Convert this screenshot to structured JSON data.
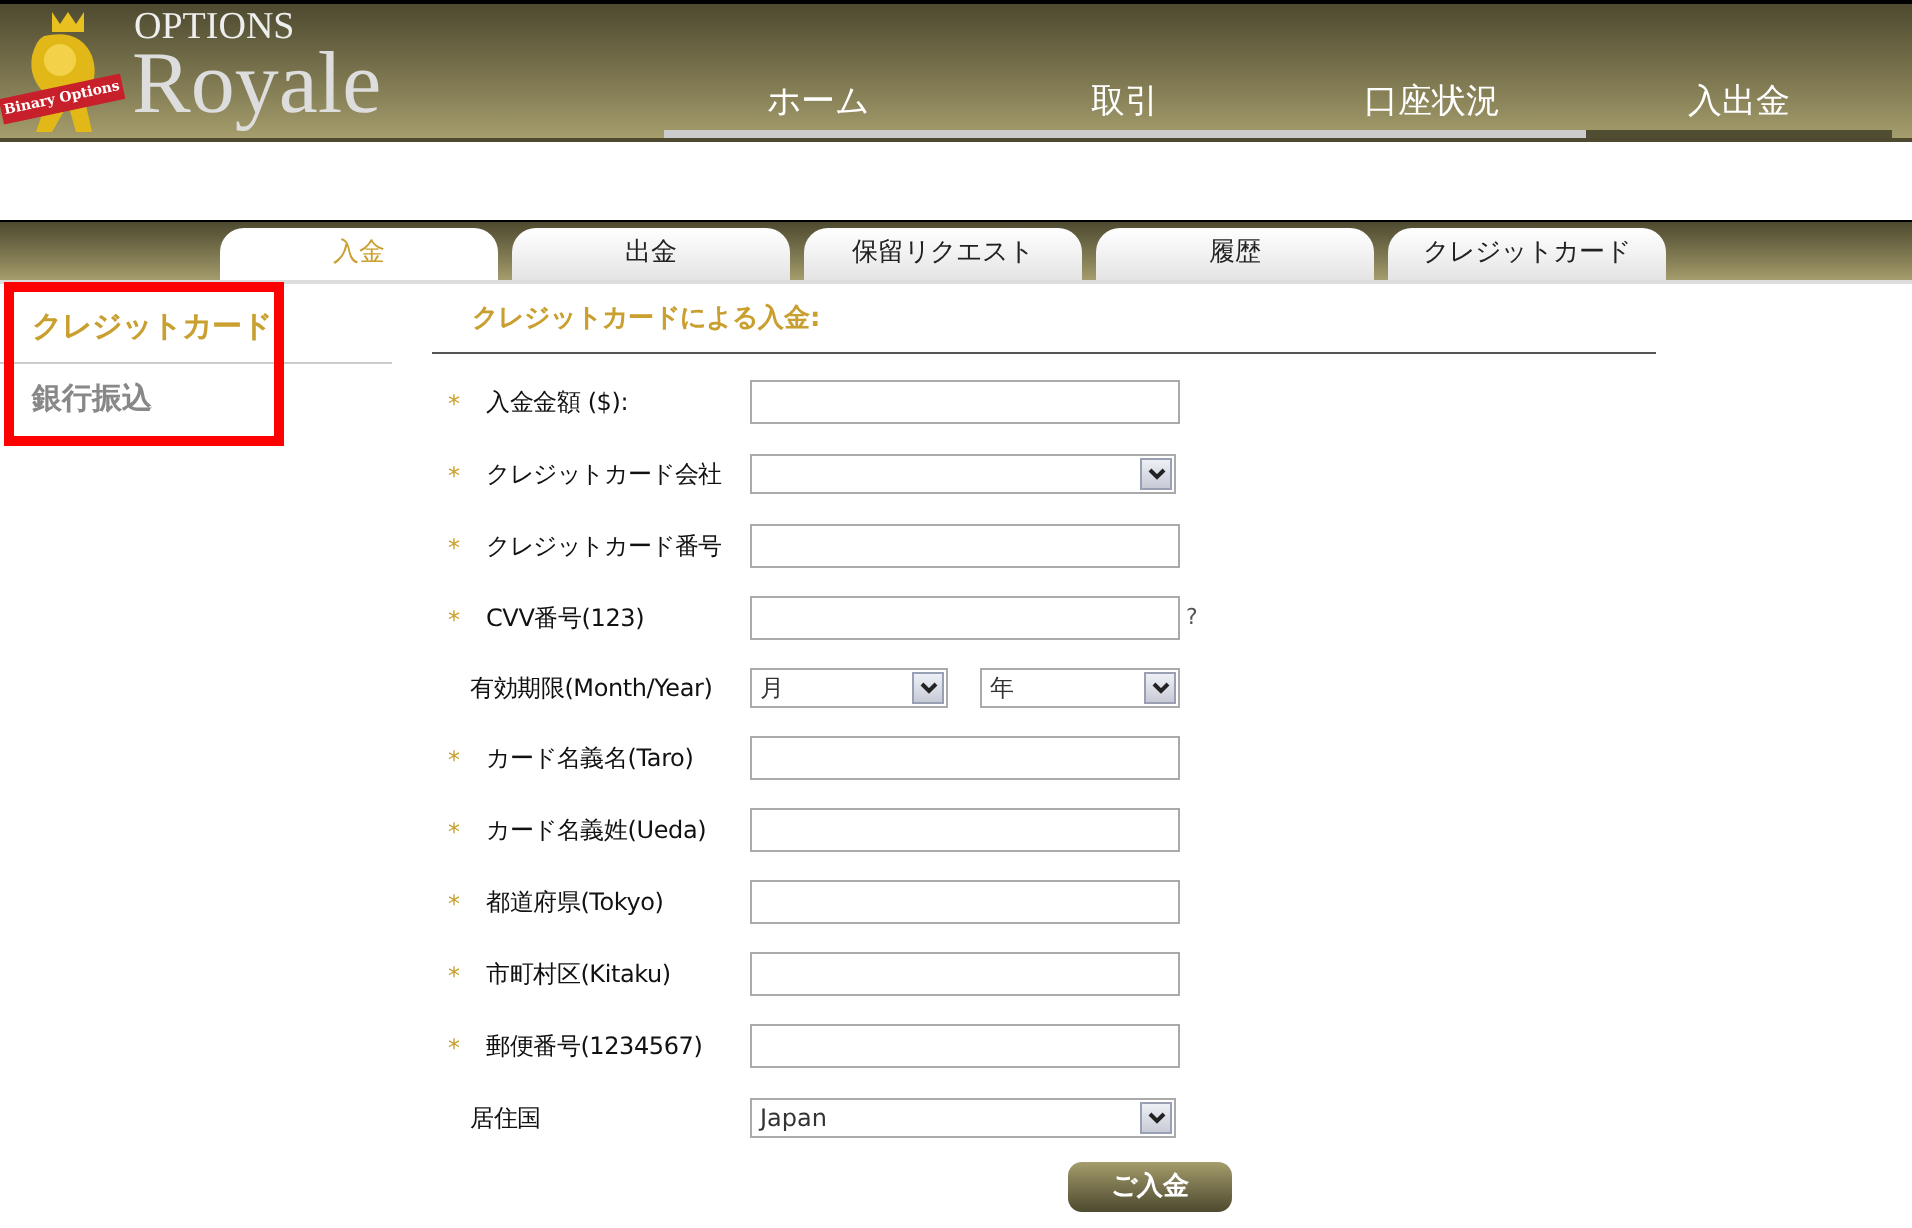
{
  "logo": {
    "ribbon": "Binary Options",
    "top": "OPTIONS",
    "main": "Royale"
  },
  "nav": [
    {
      "label": "ホーム",
      "selected": false
    },
    {
      "label": "取引",
      "selected": false
    },
    {
      "label": "口座状況",
      "selected": false
    },
    {
      "label": "入出金",
      "selected": true
    }
  ],
  "tabs": [
    {
      "label": "入金",
      "selected": true
    },
    {
      "label": "出金",
      "selected": false
    },
    {
      "label": "保留リクエスト",
      "selected": false
    },
    {
      "label": "履歴",
      "selected": false
    },
    {
      "label": "クレジットカード",
      "selected": false
    }
  ],
  "sidebar": {
    "highlighted": true,
    "items": [
      {
        "label": "クレジットカード",
        "selected": true
      },
      {
        "label": "銀行振込",
        "selected": false
      }
    ]
  },
  "form": {
    "title": "クレジットカードによる入金:",
    "fields": [
      {
        "kind": "text",
        "mark": "*",
        "label": "入金金額 ($):"
      },
      {
        "kind": "select",
        "mark": "*",
        "label": "クレジットカード会社"
      },
      {
        "kind": "text",
        "mark": "*",
        "label": "クレジットカード番号"
      },
      {
        "kind": "text",
        "mark": "*",
        "label": "CVV番号(123)",
        "hint": "?"
      },
      {
        "kind": "date",
        "label": "有効期限(Month/Year)",
        "month": "月",
        "year": "年"
      },
      {
        "kind": "text",
        "mark": "*",
        "label": "カード名義名(Taro)"
      },
      {
        "kind": "text",
        "mark": "*",
        "label": "カード名義姓(Ueda)"
      },
      {
        "kind": "text",
        "mark": "*",
        "label": "都道府県(Tokyo)"
      },
      {
        "kind": "text",
        "mark": "*",
        "label": "市町村区(Kitaku)"
      },
      {
        "kind": "text",
        "mark": "*",
        "label": "郵便番号(1234567)"
      },
      {
        "kind": "select",
        "label": "居住国",
        "value": "Japan"
      }
    ],
    "submit": "ご入金"
  }
}
